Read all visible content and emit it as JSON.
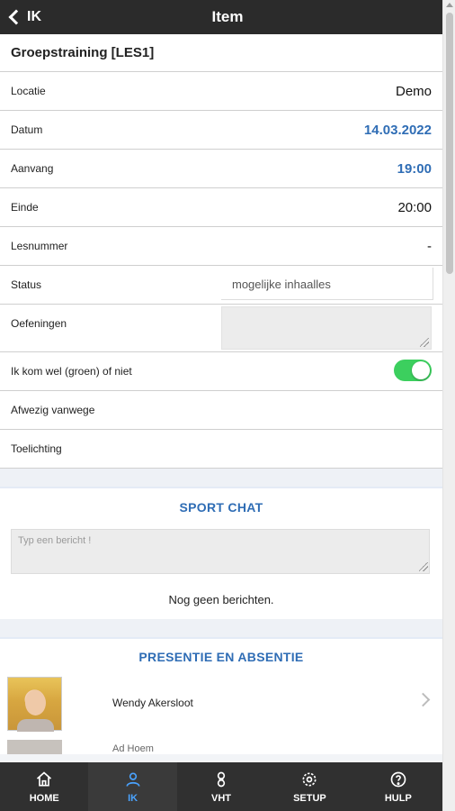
{
  "header": {
    "back_label": "IK",
    "title": "Item"
  },
  "item": {
    "title": "Groepstraining [LES1]",
    "rows": {
      "locatie": {
        "label": "Locatie",
        "value": "Demo"
      },
      "datum": {
        "label": "Datum",
        "value": "14.03.2022"
      },
      "aanvang": {
        "label": "Aanvang",
        "value": "19:00"
      },
      "einde": {
        "label": "Einde",
        "value": "20:00"
      },
      "lesnummer": {
        "label": "Lesnummer",
        "value": "-"
      },
      "status": {
        "label": "Status",
        "value": "mogelijke inhaalles"
      },
      "oefeningen": {
        "label": "Oefeningen",
        "value": ""
      },
      "aanwezig": {
        "label": "Ik kom wel (groen) of niet",
        "on": true
      },
      "afwezig": {
        "label": "Afwezig vanwege"
      },
      "toelichting": {
        "label": "Toelichting"
      }
    }
  },
  "chat": {
    "title": "SPORT CHAT",
    "placeholder": "Typ een bericht !",
    "empty": "Nog geen berichten."
  },
  "presence": {
    "title": "PRESENTIE EN ABSENTIE",
    "people": [
      {
        "name": "Wendy Akersloot"
      },
      {
        "name": "Ad Hoem"
      }
    ]
  },
  "nav": {
    "items": [
      {
        "label": "HOME",
        "icon": "home-icon"
      },
      {
        "label": "IK",
        "icon": "user-icon",
        "active": true
      },
      {
        "label": "VHT",
        "icon": "medal-icon"
      },
      {
        "label": "SETUP",
        "icon": "gear-icon"
      },
      {
        "label": "HULP",
        "icon": "help-icon"
      }
    ]
  },
  "colors": {
    "accent": "#2f6db5",
    "toggle_on": "#3ccf5e",
    "header_bg": "#2b2b2b",
    "nav_active": "#4aa3ff"
  }
}
